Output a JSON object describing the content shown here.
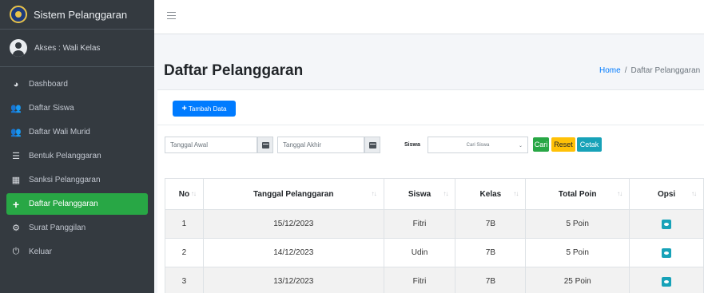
{
  "brand": {
    "title": "Sistem Pelanggaran"
  },
  "user": {
    "label": "Akses : Wali Kelas"
  },
  "sidebar": {
    "items": [
      {
        "label": "Dashboard",
        "icon": "tachometer-icon"
      },
      {
        "label": "Daftar Siswa",
        "icon": "users-icon"
      },
      {
        "label": "Daftar Wali Murid",
        "icon": "users-icon"
      },
      {
        "label": "Bentuk Pelanggaran",
        "icon": "list-icon"
      },
      {
        "label": "Sanksi Pelanggaran",
        "icon": "table-icon"
      },
      {
        "label": "Daftar Pelanggaran",
        "icon": "plus-icon",
        "active": true
      },
      {
        "label": "Surat Panggilan",
        "icon": "cogs-icon"
      },
      {
        "label": "Keluar",
        "icon": "power-icon"
      }
    ]
  },
  "page": {
    "title": "Daftar Pelanggaran"
  },
  "breadcrumb": {
    "home": "Home",
    "sep": "/",
    "current": "Daftar Pelanggaran"
  },
  "toolbar": {
    "add_label": "Tambah Data",
    "add_prefix": "+"
  },
  "filters": {
    "start_placeholder": "Tanggal Awal",
    "end_placeholder": "Tanggal Akhir",
    "siswa_label": "Siswa",
    "siswa_select": "Cari Siswa",
    "cari_label": "Cari",
    "reset_label": "Reset",
    "cetak_label": "Cetak"
  },
  "table": {
    "headers": [
      "No",
      "Tanggal Pelanggaran",
      "Siswa",
      "Kelas",
      "Total Poin",
      "Opsi"
    ],
    "sort_glyph": "↑↓",
    "rows": [
      {
        "no": "1",
        "tanggal": "15/12/2023",
        "siswa": "Fitri",
        "kelas": "7B",
        "poin": "5 Poin"
      },
      {
        "no": "2",
        "tanggal": "14/12/2023",
        "siswa": "Udin",
        "kelas": "7B",
        "poin": "5 Poin"
      },
      {
        "no": "3",
        "tanggal": "13/12/2023",
        "siswa": "Fitri",
        "kelas": "7B",
        "poin": "25 Poin"
      }
    ]
  },
  "colors": {
    "sidebar": "#343a40",
    "active": "#28a745",
    "primary": "#007bff",
    "info": "#17a2b8",
    "warning": "#ffc107"
  }
}
